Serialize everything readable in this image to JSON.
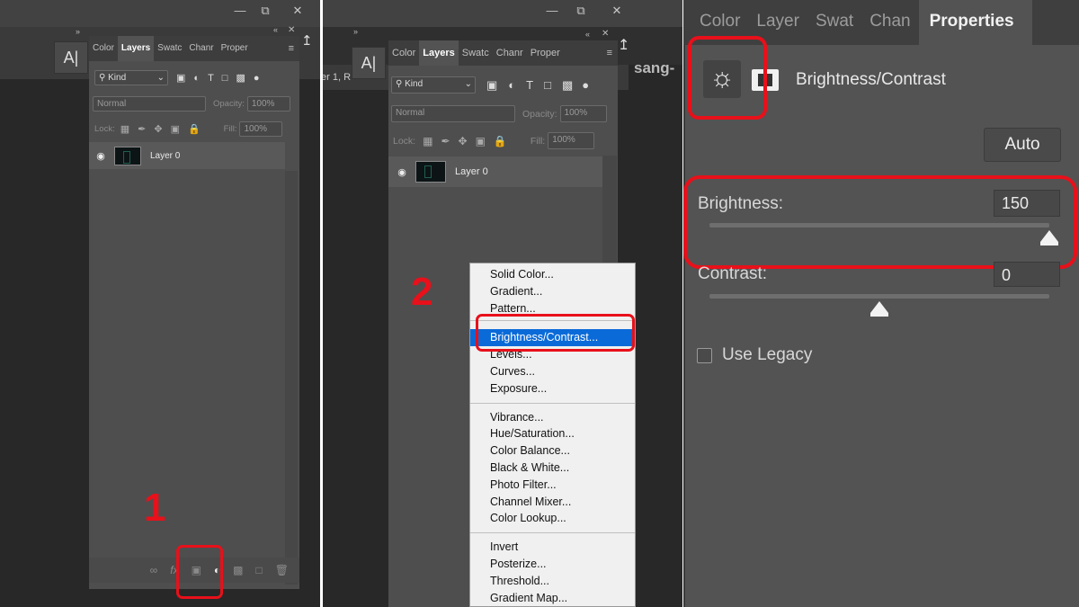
{
  "panel1": {
    "tabs": [
      "Color",
      "Layers",
      "Swatc",
      "Chanr",
      "Proper"
    ],
    "filter_label": "Kind",
    "blend_mode": "Normal",
    "opacity_label": "Opacity:",
    "opacity_value": "100%",
    "lock_label": "Lock:",
    "fill_label": "Fill:",
    "fill_value": "100%",
    "layer_name": "Layer 0",
    "step_number": "1"
  },
  "panel2": {
    "tabs": [
      "Color",
      "Layers",
      "Swatc",
      "Chanr",
      "Proper"
    ],
    "filter_label": "Kind",
    "blend_mode": "Normal",
    "opacity_label": "Opacity:",
    "opacity_value": "100%",
    "lock_label": "Lock:",
    "fill_label": "Fill:",
    "fill_value": "100%",
    "layer_name": "Layer 0",
    "doc_tab_text": "er 1, R",
    "doc_tab_text2": "sang-",
    "step_number": "2"
  },
  "adjust_menu": {
    "group1": [
      "Solid Color...",
      "Gradient...",
      "Pattern..."
    ],
    "group2": [
      "Brightness/Contrast...",
      "Levels...",
      "Curves...",
      "Exposure..."
    ],
    "group3": [
      "Vibrance...",
      "Hue/Saturation...",
      "Color Balance...",
      "Black & White...",
      "Photo Filter...",
      "Channel Mixer...",
      "Color Lookup..."
    ],
    "group4": [
      "Invert",
      "Posterize...",
      "Threshold...",
      "Gradient Map..."
    ],
    "selected": "Brightness/Contrast..."
  },
  "properties": {
    "tabs": [
      "Color",
      "Layer",
      "Swat",
      "Chan",
      "Properties"
    ],
    "adjustment_title": "Brightness/Contrast",
    "auto_label": "Auto",
    "brightness_label": "Brightness:",
    "brightness_value": "150",
    "contrast_label": "Contrast:",
    "contrast_value": "0",
    "use_legacy_label": "Use Legacy",
    "brightness_level_fraction": 1.0,
    "contrast_level_fraction": 0.5
  },
  "colors": {
    "highlight_red": "#e8101a",
    "menu_selected_blue": "#0a6bd8"
  }
}
